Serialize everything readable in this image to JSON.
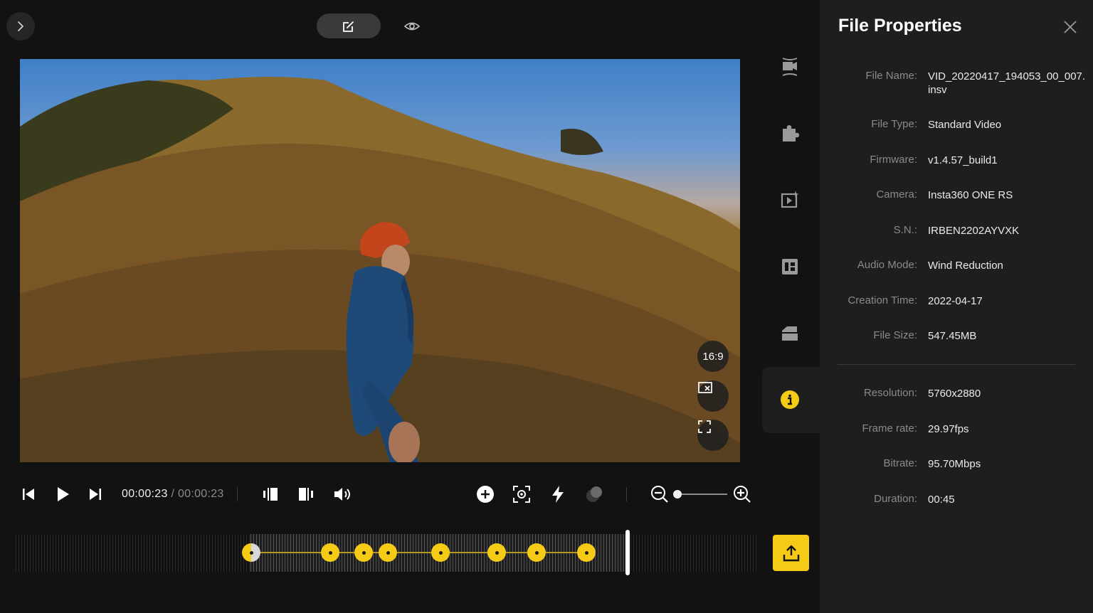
{
  "top_bar": {
    "collapse_icon": "chevron-right-icon",
    "edit_mode_icon": "edit-icon",
    "preview_icon": "eye-icon"
  },
  "video_overlay": {
    "aspect_ratio_label": "16:9",
    "crop_icon": "crop-off-icon",
    "fullscreen_icon": "fullscreen-icon"
  },
  "transport": {
    "current_time": "00:00:23",
    "separator": "/",
    "total_time": "00:00:23",
    "zoom_level": 0.1
  },
  "timeline": {
    "keyframe_count": 8
  },
  "rail": {
    "items": [
      "camera-stabilize-icon",
      "plugin-icon",
      "effects-icon",
      "ai-edit-icon",
      "clip-stack-icon",
      "info-icon"
    ],
    "active": "info-icon"
  },
  "panel": {
    "title": "File Properties",
    "props": [
      {
        "key": "File Name:",
        "value": "VID_20220417_194053_00_007.insv"
      },
      {
        "key": "File Type:",
        "value": "Standard Video"
      },
      {
        "key": "Firmware:",
        "value": "v1.4.57_build1"
      },
      {
        "key": "Camera:",
        "value": "Insta360 ONE RS"
      },
      {
        "key": "S.N.:",
        "value": "IRBEN2202AYVXK"
      },
      {
        "key": "Audio Mode:",
        "value": "Wind Reduction"
      },
      {
        "key": "Creation Time:",
        "value": "2022-04-17"
      },
      {
        "key": "File Size:",
        "value": "547.45MB"
      }
    ],
    "media": [
      {
        "key": "Resolution:",
        "value": "5760x2880"
      },
      {
        "key": "Frame rate:",
        "value": "29.97fps"
      },
      {
        "key": "Bitrate:",
        "value": "95.70Mbps"
      },
      {
        "key": "Duration:",
        "value": "00:45"
      }
    ]
  },
  "colors": {
    "accent": "#f5cb16",
    "panel_bg": "#1e1e1e",
    "main_bg": "#121212"
  }
}
